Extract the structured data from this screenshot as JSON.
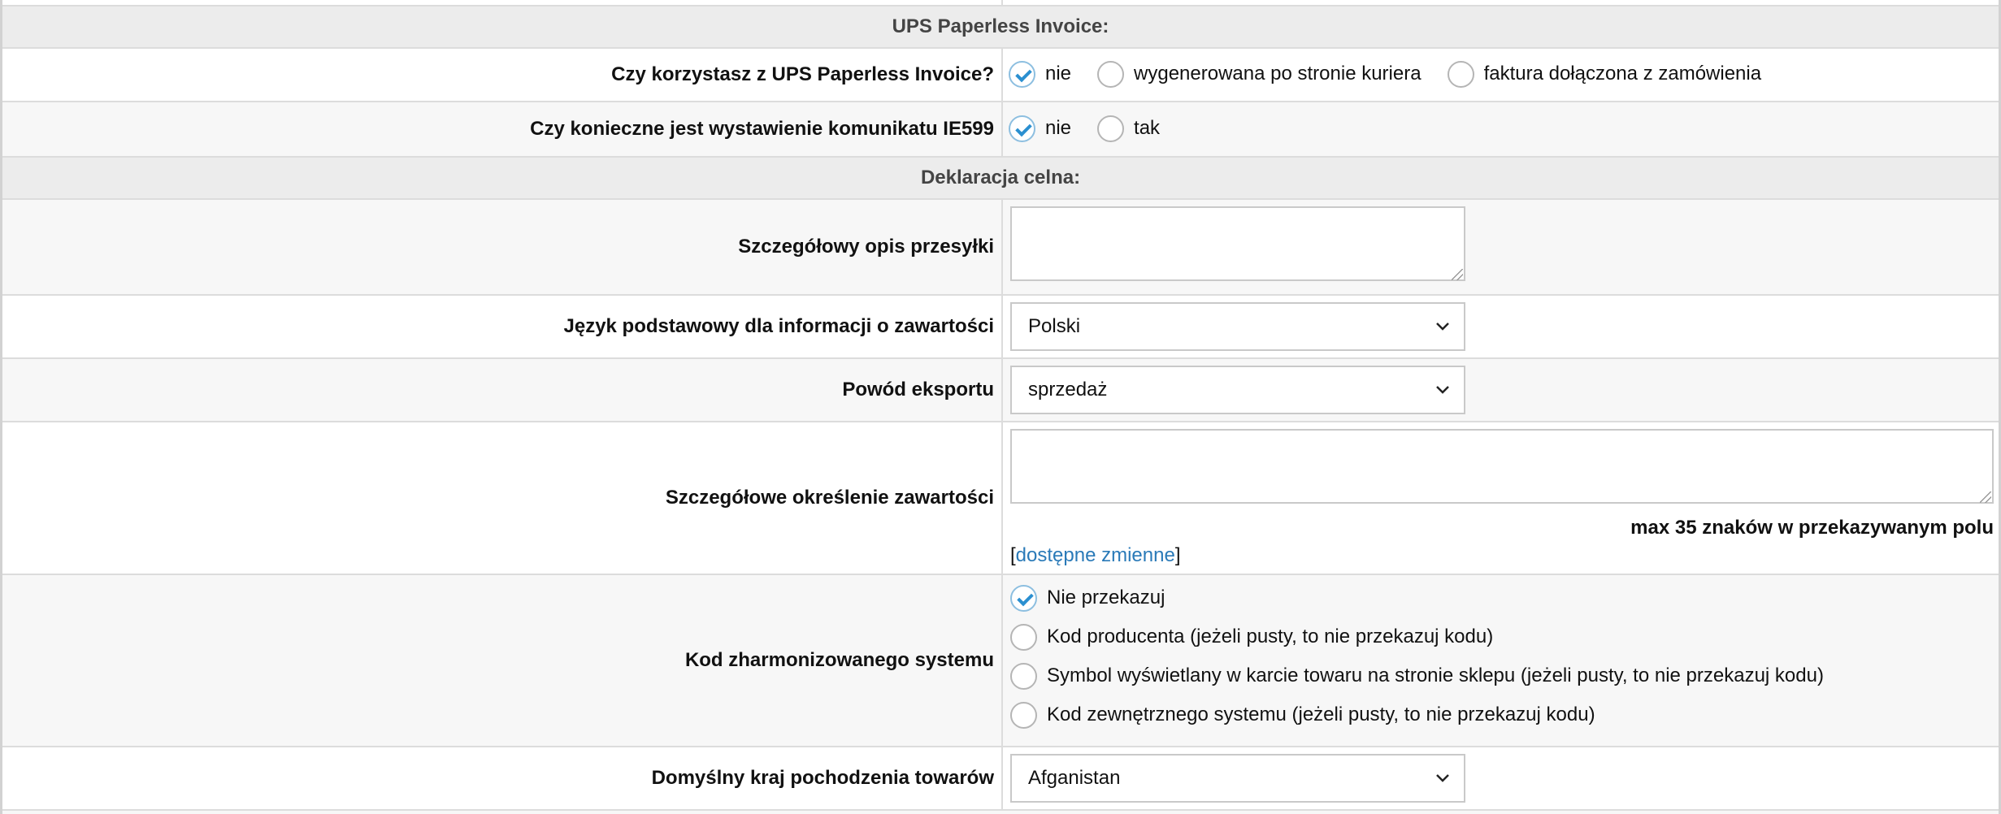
{
  "sections": {
    "ups_paperless": "UPS Paperless Invoice:",
    "customs": "Deklaracja celna:"
  },
  "paperless_invoice": {
    "label": "Czy korzystasz z UPS Paperless Invoice?",
    "options": [
      {
        "label": "nie",
        "checked": true
      },
      {
        "label": "wygenerowana po stronie kuriera",
        "checked": false
      },
      {
        "label": "faktura dołączona z zamówienia",
        "checked": false
      }
    ]
  },
  "ie599": {
    "label": "Czy konieczne jest wystawienie komunikatu IE599",
    "options": [
      {
        "label": "nie",
        "checked": true
      },
      {
        "label": "tak",
        "checked": false
      }
    ]
  },
  "shipment_description": {
    "label": "Szczegółowy opis przesyłki",
    "value": ""
  },
  "content_language": {
    "label": "Język podstawowy dla informacji o zawartości",
    "selected": "Polski"
  },
  "export_reason": {
    "label": "Powód eksportu",
    "selected": "sprzedaż"
  },
  "content_details": {
    "label": "Szczegółowe określenie zawartości",
    "value": "",
    "hint": "max 35 znaków w przekazywanym polu",
    "vars_open": "[",
    "vars_link": "dostępne zmienne",
    "vars_close": "]"
  },
  "hs_code": {
    "label": "Kod zharmonizowanego systemu",
    "options": [
      {
        "label": "Nie przekazuj",
        "checked": true
      },
      {
        "label": "Kod producenta (jeżeli pusty, to nie przekazuj kodu)",
        "checked": false
      },
      {
        "label": "Symbol wyświetlany w karcie towaru na stronie sklepu (jeżeli pusty, to nie przekazuj kodu)",
        "checked": false
      },
      {
        "label": "Kod zewnętrznego systemu (jeżeli pusty, to nie przekazuj kodu)",
        "checked": false
      }
    ]
  },
  "origin_country": {
    "label": "Domyślny kraj pochodzenia towarów",
    "selected": "Afganistan"
  }
}
